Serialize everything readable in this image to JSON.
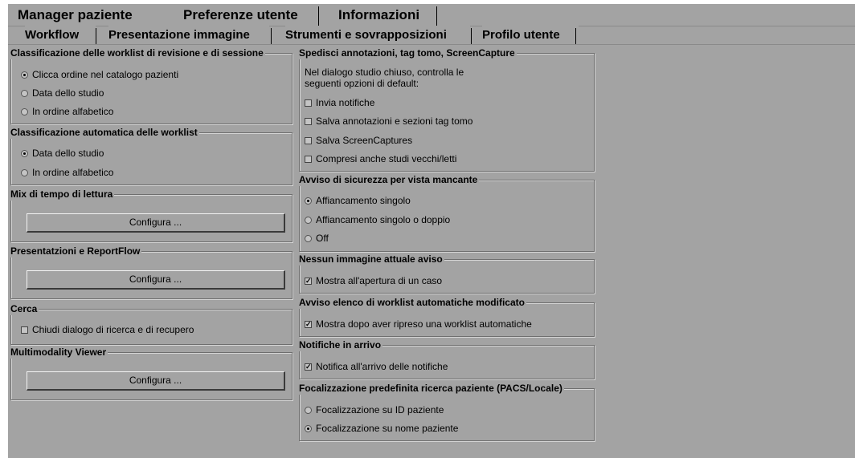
{
  "top_tabs": [
    "Manager paziente",
    "Preferenze utente",
    "Informazioni"
  ],
  "sub_tabs": [
    "Workflow",
    "Presentazione immagine",
    "Strumenti e sovrapposizioni",
    "Profilo utente"
  ],
  "left": {
    "sort_review": {
      "title": "Classificazione delle worklist di revisione e di sessione",
      "options": [
        "Clicca ordine nel catalogo pazienti",
        "Data dello studio",
        "In ordine alfabetico"
      ],
      "selected": 0
    },
    "auto_sort": {
      "title": "Classificazione automatica delle worklist",
      "options": [
        "Data dello studio",
        "In ordine alfabetico"
      ],
      "selected": 0
    },
    "reading_mix": {
      "title": "Mix di tempo di lettura",
      "button": "Configura ..."
    },
    "presentations": {
      "title": "Presentatzioni e ReportFlow",
      "button": "Configura ..."
    },
    "search": {
      "title": "Cerca",
      "checkbox": "Chiudi dialogo di ricerca e di recupero",
      "checked": false
    },
    "multimodality": {
      "title": "Multimodality Viewer",
      "button": "Configura ..."
    }
  },
  "right": {
    "send_annotations": {
      "title": "Spedisci annotazioni, tag tomo, ScreenCapture",
      "desc_line1": "Nel dialogo studio chiuso, controlla le",
      "desc_line2": "seguenti opzioni di default:",
      "checks": [
        "Invia notifiche",
        "Salva annotazioni e sezioni tag tomo",
        "Salva ScreenCaptures",
        "Compresi anche studi vecchi/letti"
      ]
    },
    "missing_view": {
      "title": "Avviso di sicurezza per vista mancante",
      "options": [
        "Affiancamento singolo",
        "Affiancamento singolo o doppio",
        "Off"
      ],
      "selected": 0
    },
    "no_current_image": {
      "title": "Nessun immagine attuale aviso",
      "checkbox": "Mostra all'apertura di un caso",
      "checked": true
    },
    "auto_worklist_changed": {
      "title": "Avviso elenco di worklist automatiche modificato",
      "checkbox": "Mostra dopo aver ripreso una worklist automatiche",
      "checked": true
    },
    "incoming_notifications": {
      "title": "Notifiche in arrivo",
      "checkbox": "Notifica all'arrivo delle notifiche",
      "checked": true
    },
    "patient_search_focus": {
      "title": "Focalizzazione predefinita ricerca paziente (PACS/Locale)",
      "options": [
        "Focalizzazione su ID paziente",
        "Focalizzazione su nome paziente"
      ],
      "selected": 1
    }
  }
}
